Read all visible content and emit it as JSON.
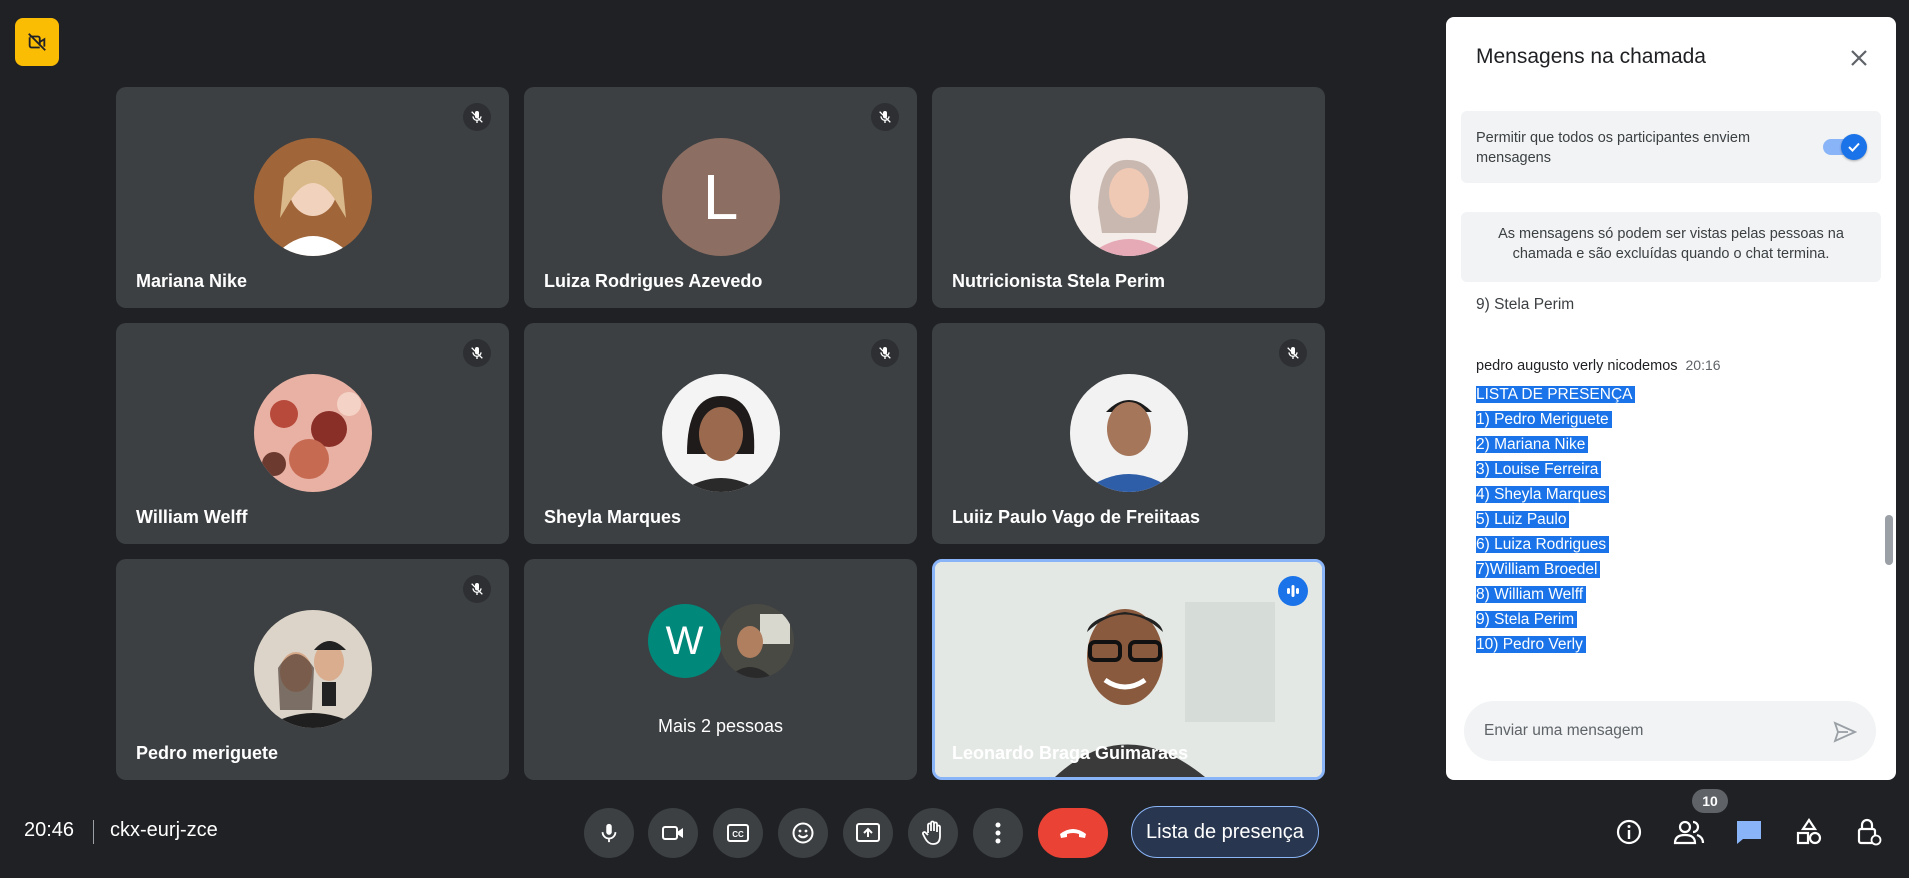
{
  "participants": [
    {
      "name": "Mariana Nike",
      "muted": true
    },
    {
      "name": "Luiza Rodrigues Azevedo",
      "muted": true,
      "initial": "L"
    },
    {
      "name": "Nutricionista Stela Perim",
      "muted": false
    },
    {
      "name": "William Welff",
      "muted": true
    },
    {
      "name": "Sheyla Marques",
      "muted": true
    },
    {
      "name": "Luiiz Paulo Vago de Freiitaas",
      "muted": true
    },
    {
      "name": "Pedro meriguete",
      "muted": true
    },
    {
      "name": "Mais 2 pessoas",
      "initial": "W"
    },
    {
      "name": "Leonardo Braga Guimaraes",
      "speaking": true
    }
  ],
  "chat": {
    "title": "Mensagens na chamada",
    "permit_text": "Permitir que todos os participantes enviem mensagens",
    "permit_enabled": true,
    "notice": "As mensagens só podem ser vistas pelas pessoas na chamada e são excluídas quando o chat termina.",
    "previous_line": "9) Stela Perim",
    "message": {
      "author": "pedro augusto verly nicodemos",
      "time": "20:16",
      "lines": [
        "LISTA DE PRESENÇA",
        "1) Pedro Meriguete",
        "2) Mariana Nike",
        "3) Louise Ferreira",
        "4) Sheyla Marques",
        "5) Luiz Paulo",
        "6) Luiza Rodrigues",
        "7)William Broedel",
        "8) William Welff",
        "9) Stela Perim",
        "10) Pedro Verly"
      ]
    },
    "input_placeholder": "Enviar uma mensagem"
  },
  "bottom_bar": {
    "clock": "20:46",
    "meeting_code": "ckx-eurj-zce",
    "activity_button": "Lista de presença",
    "people_count": "10"
  },
  "colors": {
    "background": "#202124",
    "tile": "#3c4043",
    "accent": "#1a73e8",
    "end_call": "#ea4335",
    "badge": "#fbbc04"
  },
  "icons": [
    "camera-off-icon",
    "mic-off-icon",
    "mic-icon",
    "camera-icon",
    "captions-icon",
    "emoji-icon",
    "present-icon",
    "raise-hand-icon",
    "more-options-icon",
    "end-call-icon",
    "info-icon",
    "people-icon",
    "chat-icon",
    "activities-icon",
    "host-controls-icon",
    "close-icon",
    "send-icon",
    "check-icon",
    "speaking-icon"
  ]
}
